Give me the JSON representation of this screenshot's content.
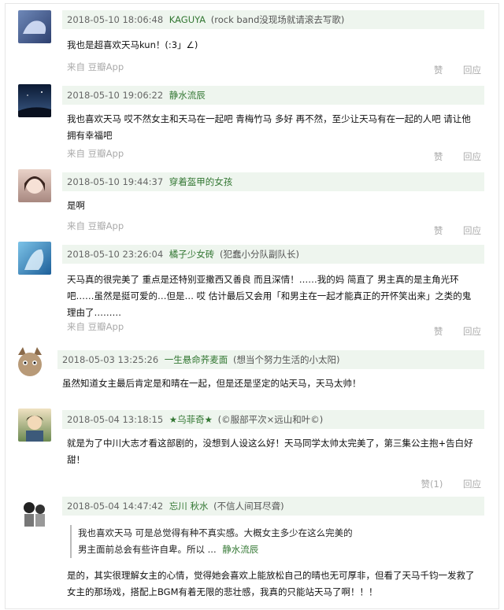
{
  "comments": [
    {
      "date": "2018-05-10 18:06:48",
      "user": "KAGUYA",
      "tag": "(rock band没现场就请滚去写歌)",
      "text": "我也是超喜欢天马kun！(:3」∠)",
      "source": "来自 豆瓣App",
      "like": "赞",
      "reply": "回应"
    },
    {
      "date": "2018-05-10 19:06:22",
      "user": "静水流辰",
      "tag": "",
      "text": "我也喜欢天马 哎不然女主和天马在一起吧 青梅竹马 多好 再不然，至少让天马有在一起的人吧 请让他拥有幸福吧",
      "source": "来自 豆瓣App",
      "like": "赞",
      "reply": "回应"
    },
    {
      "date": "2018-05-10 19:44:37",
      "user": "穿着盔甲的女孩",
      "tag": "",
      "text": "是啊",
      "source": "来自 豆瓣App",
      "like": "赞",
      "reply": "回应"
    },
    {
      "date": "2018-05-10 23:26:04",
      "user": "橘子少女砖",
      "tag": "(犯蠢小分队副队长)",
      "text": "天马真的很完美了 重点是还特别亚撒西又善良 而且深情！……我的妈 简直了 男主真的是主角光环吧……虽然是挺可爱的…但是… 哎 估计最后又会用「和男主在一起才能真正的开怀笑出来」之类的鬼理由了………",
      "source": "来自 豆瓣App",
      "like": "赞",
      "reply": "回应"
    },
    {
      "date": "2018-05-03 13:25:26",
      "user": "一生悬命荞麦面",
      "tag": "(想当个努力生活的小太阳)",
      "text": "虽然知道女主最后肯定是和晴在一起，但是还是坚定的站天马，天马太帅！",
      "source": "",
      "like": "",
      "reply": ""
    },
    {
      "date": "2018-05-04 13:18:15",
      "user": "★乌菲奇★",
      "tag": "(©服部平次×远山和叶©)",
      "text": "就是为了中川大志才看这部剧的，没想到人设这么好！天马同学太帅太完美了，第三集公主抱+告白好甜！",
      "source": "",
      "like": "赞(1)",
      "reply": "回应"
    },
    {
      "date": "2018-05-04 14:47:42",
      "user": "忘川 秋水",
      "tag": "(不信人间耳尽聋)",
      "quote": "我也喜欢天马 可是总觉得有种不真实感。大概女主多少在这么完美的男主面前总会有些许自卑。所以 ...",
      "quote_author": "静水流辰",
      "text": "是的，其实很理解女主的心情，觉得她会喜欢上能放松自己的晴也无可厚非，但看了天马千钧一发救了女主的那场戏，搭配上BGM有着无限的悲壮感，我真的只能站天马了啊！！！",
      "source": "",
      "like": "",
      "reply": ""
    }
  ]
}
